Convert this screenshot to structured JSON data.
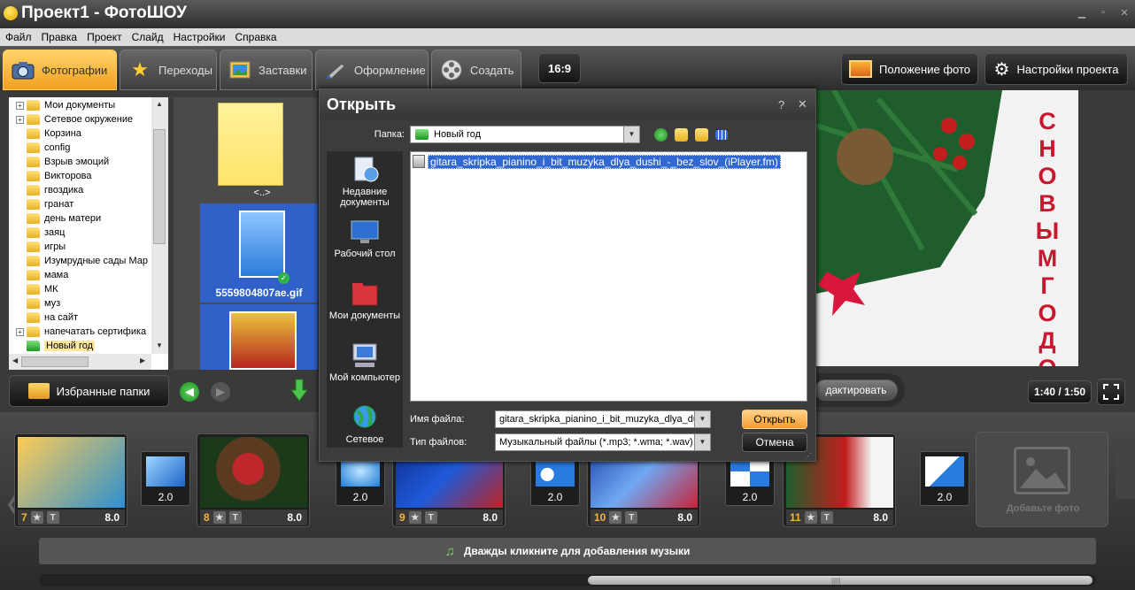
{
  "window": {
    "title": "Проект1 - ФотоШОУ"
  },
  "menu": [
    "Файл",
    "Правка",
    "Проект",
    "Слайд",
    "Настройки",
    "Справка"
  ],
  "tabs": [
    {
      "label": "Фотографии",
      "icon": "camera-icon"
    },
    {
      "label": "Переходы",
      "icon": "star-icon"
    },
    {
      "label": "Заставки",
      "icon": "picture-icon"
    },
    {
      "label": "Оформление",
      "icon": "brush-icon"
    },
    {
      "label": "Создать",
      "icon": "film-reel-icon"
    }
  ],
  "aspect": "16:9",
  "toolbar": {
    "photo_position": "Положение фото",
    "project_settings": "Настройки проекта"
  },
  "tree": {
    "items": [
      {
        "label": "Мои документы",
        "expand": true,
        "selected": false
      },
      {
        "label": "Сетевое окружение",
        "expand": true,
        "selected": false
      },
      {
        "label": "Корзина",
        "expand": false,
        "selected": false
      },
      {
        "label": "config",
        "expand": false,
        "selected": false
      },
      {
        "label": "Взрыв эмоций",
        "expand": false,
        "selected": false
      },
      {
        "label": "Викторова",
        "expand": false,
        "selected": false
      },
      {
        "label": "гвоздика",
        "expand": false,
        "selected": false
      },
      {
        "label": "гранат",
        "expand": false,
        "selected": false
      },
      {
        "label": "день матери",
        "expand": false,
        "selected": false
      },
      {
        "label": "заяц",
        "expand": false,
        "selected": false
      },
      {
        "label": "игры",
        "expand": false,
        "selected": false
      },
      {
        "label": "Изумрудные сады Мар",
        "expand": false,
        "selected": false
      },
      {
        "label": "мама",
        "expand": false,
        "selected": false
      },
      {
        "label": "МК",
        "expand": false,
        "selected": false
      },
      {
        "label": "муз",
        "expand": false,
        "selected": false
      },
      {
        "label": "на сайт",
        "expand": false,
        "selected": false
      },
      {
        "label": "напечатать сертифика",
        "expand": true,
        "selected": false
      },
      {
        "label": "Новый год",
        "expand": false,
        "selected": true
      }
    ]
  },
  "thumbs": {
    "up_label": "<..>",
    "file1": "5559804807ae.gif"
  },
  "favorites": "Избранные папки",
  "dialog": {
    "title": "Открыть",
    "help": "?",
    "close": "✕",
    "folder_label": "Папка:",
    "folder_value": "Новый год",
    "places": [
      "Недавние документы",
      "Рабочий стол",
      "Мои документы",
      "Мой компьютер",
      "Сетевое"
    ],
    "files": [
      "gitara_skripka_pianino_i_bit_muzyka_dlya_dushi_-_bez_slov_(iPlayer.fm)"
    ],
    "filename_label": "Имя файла:",
    "filename_value": "gitara_skripka_pianino_i_bit_muzyka_dlya_dus",
    "filetype_label": "Тип файлов:",
    "filetype_value": "Музыкальный файлы (*.mp3; *.wma; *.wav)",
    "open_button": "Открыть",
    "cancel_button": "Отмена"
  },
  "preview": {
    "caption": "С НОВЫМ ГОДОМ",
    "edit_button": "дактировать",
    "time": "1:40 / 1:50"
  },
  "timeline": {
    "slides": [
      {
        "num": "7",
        "dur": "8.0"
      },
      {
        "num": "8",
        "dur": "8.0"
      },
      {
        "num": "9",
        "dur": "8.0"
      },
      {
        "num": "10",
        "dur": "8.0"
      },
      {
        "num": "11",
        "dur": "8.0"
      }
    ],
    "transitions": [
      "2.0",
      "2.0",
      "2.0",
      "2.0",
      "2.0"
    ],
    "slide_icons": {
      "star": "★",
      "text": "T"
    },
    "add_photo": "Добавьте фото",
    "music_hint": "Дважды кликните для добавления музыки"
  },
  "colors": {
    "accent": "#f5b43a",
    "selection": "#3167d0",
    "dialog_bg": "#3c3c3c"
  }
}
